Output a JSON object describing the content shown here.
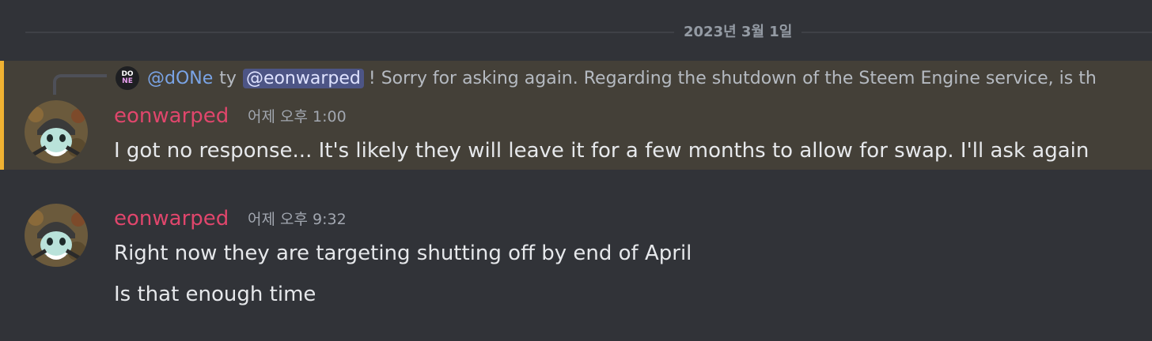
{
  "date_divider": {
    "label": "2023년 3월 1일"
  },
  "messages": [
    {
      "reply": {
        "avatar_icon": "done-logo",
        "author": "@dONe",
        "text_before_mention": "ty",
        "mention": "@eonwarped",
        "text_after_mention": "! Sorry for asking again. Regarding the shutdown of the Steem Engine service, is th"
      },
      "username": "eonwarped",
      "timestamp": "어제 오후 1:00",
      "lines": [
        "I got no response... It's likely they will leave it for a few months to allow for swap. I'll ask again"
      ],
      "highlighted": true
    },
    {
      "username": "eonwarped",
      "timestamp": "어제 오후 9:32",
      "lines": [
        "Right now they are targeting shutting off by end of April",
        "Is that enough time"
      ],
      "highlighted": false
    }
  ],
  "colors": {
    "background": "#313338",
    "highlight_background": "#444038",
    "highlight_border": "#f0b232",
    "username": "#e0466c",
    "mention_bg": "#4d5585"
  }
}
